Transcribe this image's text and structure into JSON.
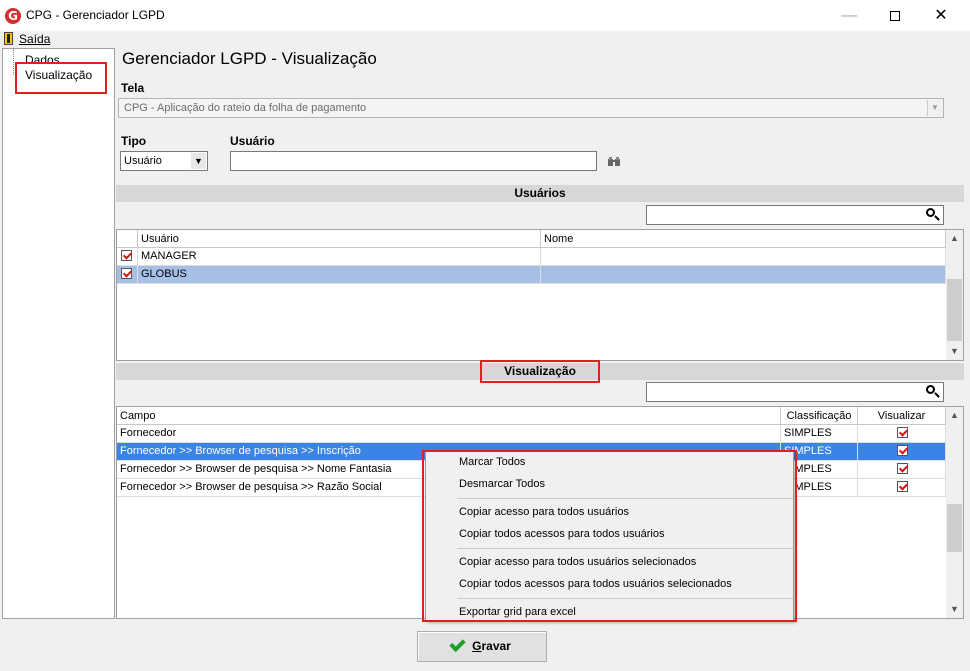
{
  "window": {
    "title": "CPG - Gerenciador LGPD",
    "app_icon_letter": "G",
    "minimize_glyph": "—",
    "close_glyph": "✕"
  },
  "menubar": {
    "saida_first": "S",
    "saida_rest": "aída"
  },
  "tree": {
    "items": [
      {
        "label": "Dados"
      },
      {
        "label": "Visualização"
      }
    ]
  },
  "header": {
    "title": "Gerenciador LGPD - Visualização"
  },
  "form": {
    "tela_label": "Tela",
    "tela_value": "CPG - Aplicação do rateio da folha de pagamento",
    "tipo_label": "Tipo",
    "tipo_value": "Usuário",
    "usuario_label": "Usuário",
    "usuario_value": ""
  },
  "usuarios_section": {
    "title": "Usuários",
    "search_value": "",
    "columns": [
      "Usuário",
      "Nome"
    ],
    "rows": [
      {
        "checked": true,
        "usuario": "MANAGER",
        "nome": ""
      },
      {
        "checked": true,
        "usuario": "GLOBUS",
        "nome": ""
      }
    ]
  },
  "visualizacao_section": {
    "title": "Visualização",
    "search_value": "",
    "columns": [
      "Campo",
      "Classificação",
      "Visualizar"
    ],
    "rows": [
      {
        "campo": "Fornecedor",
        "classificacao": "SIMPLES",
        "visualizar": true
      },
      {
        "campo": "Fornecedor >> Browser de pesquisa >> Inscrição",
        "classificacao": "SIMPLES",
        "visualizar": true
      },
      {
        "campo": "Fornecedor >> Browser de pesquisa >> Nome Fantasia",
        "classificacao": "SIMPLES",
        "visualizar": true
      },
      {
        "campo": "Fornecedor >> Browser de pesquisa >> Razão Social",
        "classificacao": "SIMPLES",
        "visualizar": true
      }
    ]
  },
  "context_menu": {
    "items": [
      "Marcar Todos",
      "Desmarcar Todos",
      "Copiar acesso para todos usuários",
      "Copiar todos acessos para todos usuários",
      "Copiar acesso para todos usuários selecionados",
      "Copiar todos acessos para todos usuários selecionados",
      "Exportar grid para excel"
    ]
  },
  "footer": {
    "gravar_first": "G",
    "gravar_rest": "ravar"
  },
  "colors": {
    "highlight_red": "#e21e1e",
    "row_selected": "#a7bfe6",
    "row_selected_focus": "#3a84e6",
    "check_green": "#1aa128"
  },
  "icons": [
    "app-logo-icon",
    "exit-icon",
    "binoculars-icon",
    "search-icon",
    "checkmark-icon"
  ]
}
